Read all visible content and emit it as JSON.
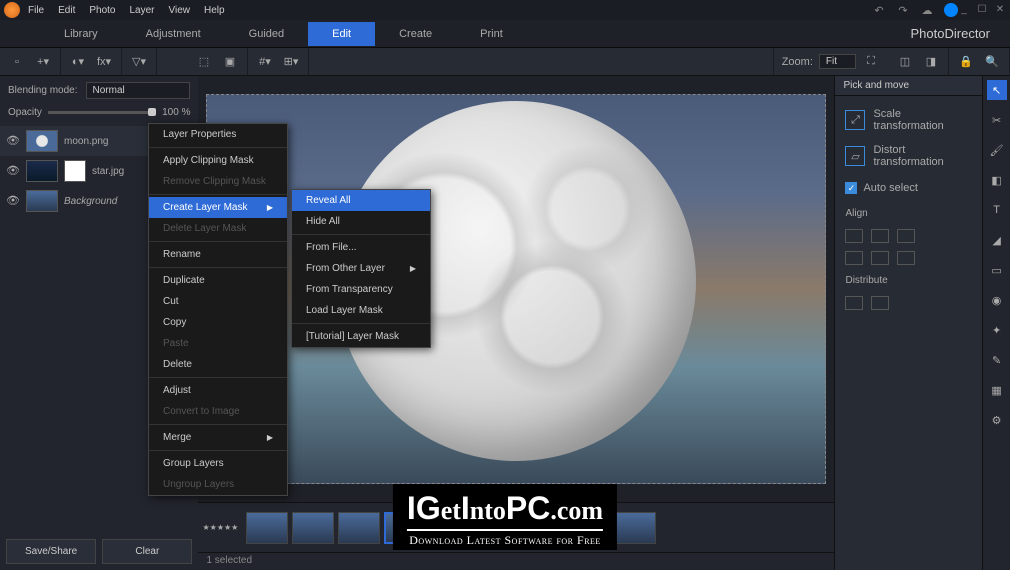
{
  "menubar": [
    "File",
    "Edit",
    "Photo",
    "Layer",
    "View",
    "Help"
  ],
  "tabs": [
    "Library",
    "Adjustment",
    "Guided",
    "Edit",
    "Create",
    "Print"
  ],
  "active_tab": "Edit",
  "brand": "PhotoDirector",
  "zoom": {
    "label": "Zoom:",
    "value": "Fit"
  },
  "blending": {
    "label": "Blending mode:",
    "value": "Normal"
  },
  "opacity": {
    "label": "Opacity",
    "value": "100 %"
  },
  "layers": [
    {
      "name": "moon.png",
      "hasMask": false
    },
    {
      "name": "star.jpg",
      "hasMask": true
    },
    {
      "name": "Background",
      "isBg": true
    }
  ],
  "buttons": {
    "save": "Save/Share",
    "clear": "Clear"
  },
  "status": "1 selected",
  "right": {
    "header": "Pick and move",
    "scale": "Scale\ntransformation",
    "scale1": "Scale",
    "scale2": "transformation",
    "distort1": "Distort",
    "distort2": "transformation",
    "autoselect": "Auto select",
    "align": "Align",
    "distribute": "Distribute"
  },
  "ctx1": [
    {
      "t": "Layer Properties",
      "type": "item"
    },
    {
      "type": "sep"
    },
    {
      "t": "Apply Clipping Mask",
      "type": "item"
    },
    {
      "t": "Remove Clipping Mask",
      "type": "disabled"
    },
    {
      "type": "sep"
    },
    {
      "t": "Create Layer Mask",
      "type": "hover",
      "sub": true
    },
    {
      "t": "Delete Layer Mask",
      "type": "disabled"
    },
    {
      "type": "sep"
    },
    {
      "t": "Rename",
      "type": "item"
    },
    {
      "type": "sep"
    },
    {
      "t": "Duplicate",
      "type": "item"
    },
    {
      "t": "Cut",
      "type": "item"
    },
    {
      "t": "Copy",
      "type": "item"
    },
    {
      "t": "Paste",
      "type": "disabled"
    },
    {
      "t": "Delete",
      "type": "item"
    },
    {
      "type": "sep"
    },
    {
      "t": "Adjust",
      "type": "item"
    },
    {
      "t": "Convert to Image",
      "type": "disabled"
    },
    {
      "type": "sep"
    },
    {
      "t": "Merge",
      "type": "item",
      "sub": true
    },
    {
      "type": "sep"
    },
    {
      "t": "Group Layers",
      "type": "item"
    },
    {
      "t": "Ungroup Layers",
      "type": "disabled"
    }
  ],
  "ctx2": [
    {
      "t": "Reveal All",
      "type": "hover"
    },
    {
      "t": "Hide All",
      "type": "item"
    },
    {
      "type": "sep"
    },
    {
      "t": "From File...",
      "type": "item"
    },
    {
      "t": "From Other Layer",
      "type": "item",
      "sub": true
    },
    {
      "t": "From Transparency",
      "type": "item"
    },
    {
      "t": "Load Layer Mask",
      "type": "item"
    },
    {
      "type": "sep"
    },
    {
      "t": "[Tutorial] Layer Mask",
      "type": "item"
    }
  ],
  "watermark": {
    "main": "IGetIntoPC.com",
    "sub": "Download Latest Software for Free"
  }
}
